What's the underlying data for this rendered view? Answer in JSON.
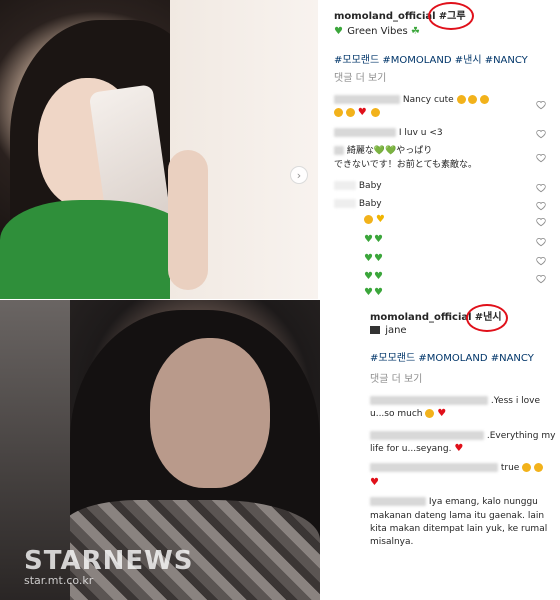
{
  "colors": {
    "link_blue": "#003569",
    "muted_gray": "#8e8e8e",
    "annotation_red": "#e0101a",
    "heart_green": "#3ba63b"
  },
  "top_post": {
    "username": "momoland_official",
    "marked_hashtag": "#그루",
    "caption": "Green Vibes",
    "caption_icon": "shamrock-icon",
    "hashtags": "#모모랜드 #MOMOLAND #낸시 #NANCY",
    "more_comments": "댓글 더 보기",
    "comments": [
      {
        "text": "Nancy cute"
      },
      {
        "text": "I luv u <3"
      },
      {
        "text": "綺麗な💚💚やっぱり"
      },
      {
        "text": "できないです！お前とても素敵な。"
      },
      {
        "text": "Baby"
      },
      {
        "text": "Baby"
      }
    ],
    "arrow_icon": "chevron-right-icon"
  },
  "bottom_post": {
    "username": "momoland_official",
    "marked_hashtag": "#낸시",
    "caption": "jane",
    "caption_icon": "clapperboard-icon",
    "hashtags": "#모모랜드 #MOMOLAND #NANCY",
    "more_comments": "댓글 더 보기",
    "comments": [
      {
        "text": ".Yess i love"
      },
      {
        "text": "u...so much"
      },
      {
        "text": ".Everything my"
      },
      {
        "text": "life for u...seyang."
      },
      {
        "text": "true"
      },
      {
        "text": "Iya emang, kalo nunggu"
      },
      {
        "text": "makanan dateng lama itu gaenak. lain"
      },
      {
        "text": "kita makan ditempat lain yuk, ke rumal"
      },
      {
        "text": "misalnya."
      }
    ],
    "arrow_icon": "chevron-right-icon"
  },
  "watermark": {
    "logo": "STARNEWS",
    "url": "star.mt.co.kr"
  }
}
